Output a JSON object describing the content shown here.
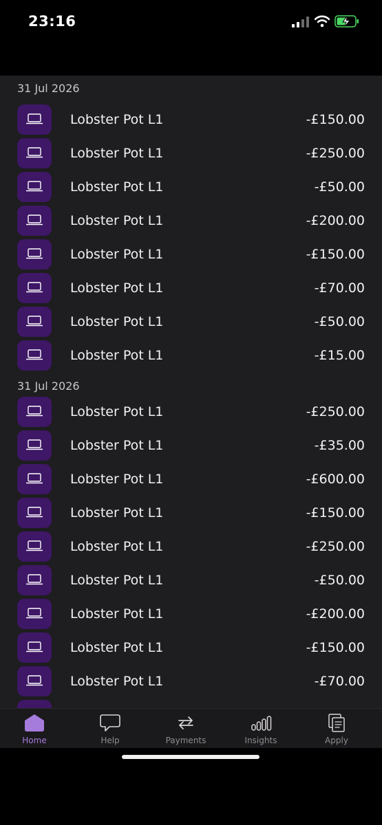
{
  "status_bar": {
    "time": "23:16"
  },
  "groups": [
    {
      "date": "31 Jul 2026",
      "transactions": [
        {
          "name": "Lobster Pot L1",
          "amount": "-£150.00"
        },
        {
          "name": "Lobster Pot L1",
          "amount": "-£250.00"
        },
        {
          "name": "Lobster Pot L1",
          "amount": "-£50.00"
        },
        {
          "name": "Lobster Pot L1",
          "amount": "-£200.00"
        },
        {
          "name": "Lobster Pot L1",
          "amount": "-£150.00"
        },
        {
          "name": "Lobster Pot L1",
          "amount": "-£70.00"
        },
        {
          "name": "Lobster Pot L1",
          "amount": "-£50.00"
        },
        {
          "name": "Lobster Pot L1",
          "amount": "-£15.00"
        }
      ]
    },
    {
      "date": "31 Jul 2026",
      "transactions": [
        {
          "name": "Lobster Pot L1",
          "amount": "-£250.00"
        },
        {
          "name": "Lobster Pot L1",
          "amount": "-£35.00"
        },
        {
          "name": "Lobster Pot L1",
          "amount": "-£600.00"
        },
        {
          "name": "Lobster Pot L1",
          "amount": "-£150.00"
        },
        {
          "name": "Lobster Pot L1",
          "amount": "-£250.00"
        },
        {
          "name": "Lobster Pot L1",
          "amount": "-£50.00"
        },
        {
          "name": "Lobster Pot L1",
          "amount": "-£200.00"
        },
        {
          "name": "Lobster Pot L1",
          "amount": "-£150.00"
        },
        {
          "name": "Lobster Pot L1",
          "amount": "-£70.00"
        },
        {
          "name": "",
          "amount": ""
        }
      ]
    }
  ],
  "tabs": [
    {
      "label": "Home",
      "icon": "home-icon",
      "active": true
    },
    {
      "label": "Help",
      "icon": "chat-bubble-icon",
      "active": false
    },
    {
      "label": "Payments",
      "icon": "transfer-arrows-icon",
      "active": false
    },
    {
      "label": "Insights",
      "icon": "bar-chart-icon",
      "active": false
    },
    {
      "label": "Apply",
      "icon": "documents-icon",
      "active": false
    }
  ],
  "colors": {
    "accent": "#a57bdc",
    "icon_tile": "#3e1766",
    "list_bg": "#1e1d1f",
    "battery_charge": "#4cd964"
  }
}
